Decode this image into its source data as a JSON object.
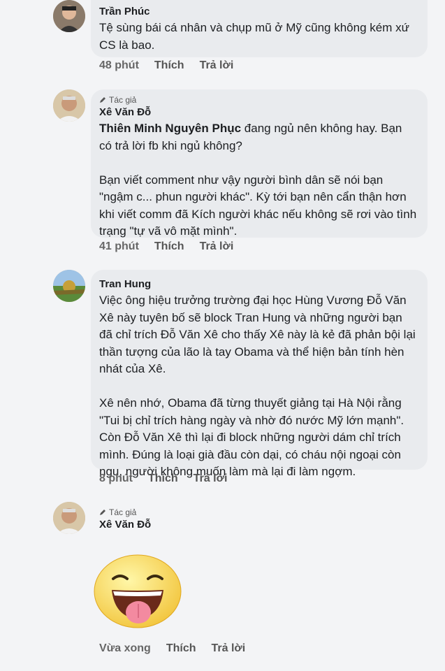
{
  "comments": [
    {
      "author": "Trần Phúc",
      "text": "Tệ sùng bái cá nhân và chụp mũ ở Mỹ cũng không kém xứ CS là bao.",
      "time": "48 phút",
      "like": "Thích",
      "reply": "Trả lời"
    },
    {
      "badge": "Tác giả",
      "author": "Xê Văn Đỗ",
      "mention": "Thiên Minh Nguyên Phục",
      "text": " đang ngủ nên không hay. Bạn có trả lời fb khi ngủ không?\n\nBạn viết comment như vậy người bình dân sẽ nói bạn \"ngậm c... phun người khác\". Kỳ tới bạn nên cẩn thận hơn khi viết comm đã Kích người khác nếu không sẽ rơi vào tình trạng \"tự vã vô mặt mình\".",
      "time": "41 phút",
      "like": "Thích",
      "reply": "Trả lời"
    },
    {
      "author": "Tran Hung",
      "text": "Việc ông hiệu trưởng trường đại học Hùng Vương Đỗ Văn Xê này tuyên bố sẽ block Tran Hung và những người bạn đã chỉ trích Đỗ Văn Xê cho thấy Xê này là kẻ đã phản bội lại thần tượng của lão là tay Obama và thể hiện bản tính hèn nhát của Xê.\n\nXê nên nhớ, Obama đã từng thuyết giảng tại Hà Nội rằng \"Tui bị chỉ trích hàng ngày và nhờ đó nước Mỹ lớn mạnh\". Còn Đỗ Văn Xê thì lại đi block những người dám chỉ trích mình. Đúng là loại già đầu còn dại, có cháu nội ngoại còn ngu, người không muốn làm mà lại đi làm ngợm.",
      "time": "8 phút",
      "like": "Thích",
      "reply": "Trả lời"
    },
    {
      "badge": "Tác giả",
      "author": "Xê Văn Đỗ",
      "sticker": "tongue-out-emoji-sticker",
      "time": "Vừa xong",
      "like": "Thích",
      "reply": "Trả lời"
    }
  ]
}
